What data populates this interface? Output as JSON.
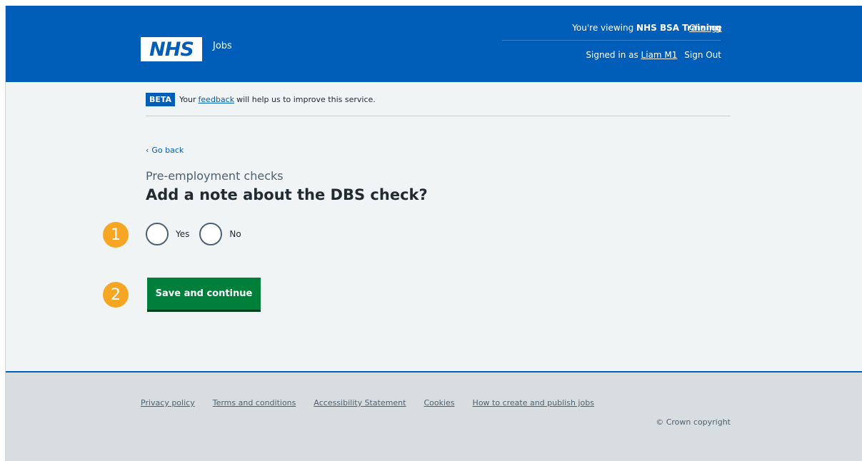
{
  "header": {
    "logo_text": "NHS",
    "service_name": "Jobs",
    "viewing_prefix": "You're viewing ",
    "viewing_org": "NHS BSA Training",
    "change_label": "Change",
    "signed_in_prefix": "Signed in as ",
    "user_name": "Liam M1",
    "sign_out_label": "Sign Out"
  },
  "beta_banner": {
    "tag": "BETA",
    "text_before": "Your",
    "link_text": "feedback",
    "text_after": "will help us to improve this service."
  },
  "nav": {
    "back_label": "Go back"
  },
  "page": {
    "caption": "Pre-employment checks",
    "title": "Add a note about the DBS check?"
  },
  "form": {
    "options": [
      {
        "label": "Yes",
        "checked": false
      },
      {
        "label": "No",
        "checked": false
      }
    ],
    "submit_label": "Save and continue"
  },
  "markers": [
    "1",
    "2"
  ],
  "footer": {
    "links": [
      "Privacy policy",
      "Terms and conditions",
      "Accessibility Statement",
      "Cookies",
      "How to create and publish jobs"
    ],
    "copyright": "© Crown copyright"
  },
  "colors": {
    "brand_blue": "#005eb8",
    "button_green": "#007f3b",
    "marker_orange": "#f6a623",
    "page_bg": "#f0f4f5",
    "footer_bg": "#d8dde0"
  }
}
